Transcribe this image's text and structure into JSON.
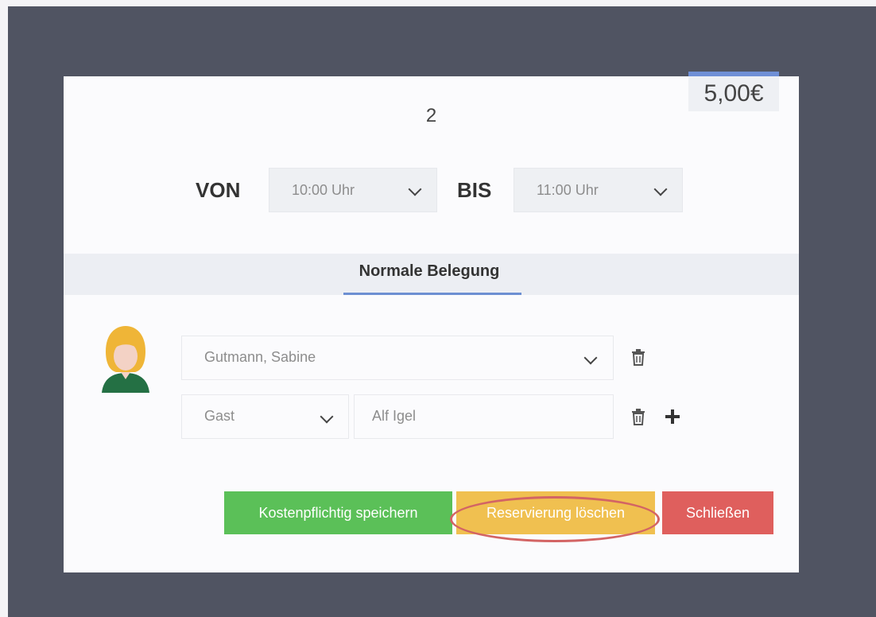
{
  "modal": {
    "price": "5,00€",
    "title": "2",
    "time": {
      "from_label": "VON",
      "from_value": "10:00 Uhr",
      "to_label": "BIS",
      "to_value": "11:00 Uhr"
    },
    "tab": {
      "label": "Normale Belegung"
    },
    "occupants": {
      "primary_value": "Gutmann, Sabine",
      "guest_type_value": "Gast",
      "guest_name_value": "Alf Igel"
    },
    "buttons": {
      "save_label": "Kostenpflichtig speichern",
      "delete_label": "Reservierung löschen",
      "close_label": "Schließen"
    }
  },
  "colors": {
    "backdrop": "#505462",
    "save": "#5bc058",
    "delete": "#f0c050",
    "close": "#df5f5d",
    "tab_accent": "#6d8fd2",
    "highlight_circle": "#d36464"
  },
  "icons": {
    "avatar": "female-user-avatar",
    "trash": "trash-icon",
    "add": "plus-icon",
    "dropdown": "chevron-down-icon"
  }
}
